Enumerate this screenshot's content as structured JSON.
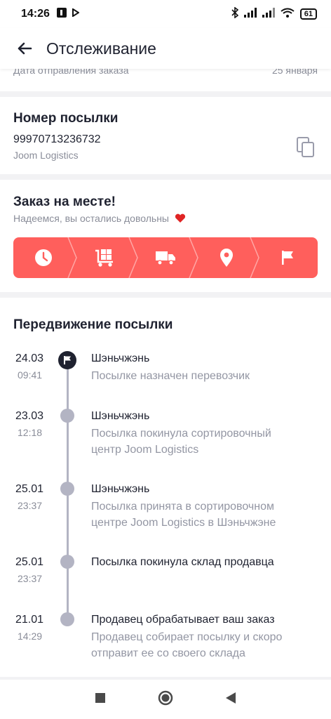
{
  "status_bar": {
    "time": "14:26",
    "battery": "61"
  },
  "app_bar": {
    "title": "Отслеживание"
  },
  "order_peek": {
    "label": "Дата отправления заказа",
    "value": "25 января"
  },
  "parcel": {
    "heading": "Номер посылки",
    "tracking_number": "99970713236732",
    "carrier": "Joom Logistics"
  },
  "delivery_status": {
    "heading": "Заказ на месте!",
    "subtitle": "Надеемся, вы остались довольны",
    "accent_color": "#ff5f5c",
    "steps": [
      "clock-icon",
      "warehouse-cart-icon",
      "truck-icon",
      "location-pin-icon",
      "flag-icon"
    ]
  },
  "movement": {
    "heading": "Передвижение посылки",
    "events": [
      {
        "date": "24.03",
        "time": "09:41",
        "title": "Шэньчжэнь",
        "desc_lines": [
          "Посылке назначен перевозчик"
        ]
      },
      {
        "date": "23.03",
        "time": "12:18",
        "title": "Шэньчжэнь",
        "desc_lines": [
          "Посылка покинула сортировочный",
          "центр Joom Logistics"
        ]
      },
      {
        "date": "25.01",
        "time": "23:37",
        "title": "Шэньчжэнь",
        "desc_lines": [
          "Посылка принята в сортировочном",
          "центре Joom Logistics в Шэньчжэне"
        ]
      },
      {
        "date": "25.01",
        "time": "23:37",
        "title": "Посылка покинула склад продавца",
        "desc_lines": []
      },
      {
        "date": "21.01",
        "time": "14:29",
        "title": "Продавец обрабатывает ваш заказ",
        "desc_lines": [
          "Продавец собирает посылку и скоро",
          "отправит ее со своего склада"
        ]
      }
    ]
  }
}
